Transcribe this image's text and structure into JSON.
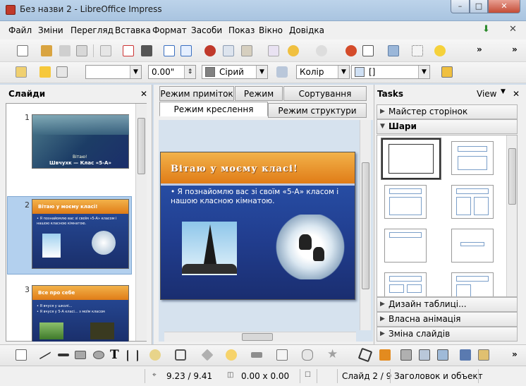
{
  "window": {
    "title": "Без назви 2 - LibreOffice Impress",
    "min": "–",
    "max": "□",
    "close": "✕"
  },
  "menu": {
    "items": [
      "Файл",
      "Зміни",
      "Перегляд",
      "Вставка",
      "Формат",
      "Засоби",
      "Показ",
      "Вікно",
      "Довідка"
    ]
  },
  "toolbar2": {
    "line_width": "0.00\"",
    "line_color": "Сірий",
    "fill_type": "Колір",
    "fill_value": "[]"
  },
  "slides_panel": {
    "title": "Слайди",
    "close": "✕",
    "numbers": [
      "1",
      "2",
      "3"
    ]
  },
  "slide_thumbs": {
    "s1": {
      "title": "Швчухк — Клас «5-А»",
      "label": "Вітаю!"
    },
    "s2": {
      "title": "Вітаю у моєму класі!",
      "bullet": "• Я познайомлю вас зі своїм «5-А» класом і нашою класною кімнатою."
    },
    "s3": {
      "title": "Все про себе",
      "b1": "• Я вчуся у школі...",
      "b2": "• Я вчуся у 5-А класі...  з моїм класом"
    }
  },
  "tabs": {
    "notes": "Режим приміток",
    "handout": "Режим тез",
    "sorter": "Сортування слайду",
    "drawing": "Режим креслення",
    "outline": "Режим структури"
  },
  "slide": {
    "title": "Вітаю у моєму класі!",
    "bullet": "Я познайомлю вас зі своїм «5-А» класом і нашою класною кімнатою."
  },
  "tasks": {
    "title": "Tasks",
    "view": "View",
    "close": "✕",
    "sections": {
      "master": "Майстер сторінок",
      "layouts": "Шари",
      "table": "Дизайн таблиці...",
      "anim": "Власна анімація",
      "transition": "Зміна слайдів"
    }
  },
  "status": {
    "position": "9.23 / 9.41",
    "size": "0.00 x 0.00",
    "slide": "Слайд 2 / 9",
    "layout": "Заголовок и объект"
  },
  "colors": {
    "accent": "#3c6fc4",
    "slide_band": "#e98a1f",
    "line_color": "#808080",
    "fill_color": "#cfe0f4"
  }
}
